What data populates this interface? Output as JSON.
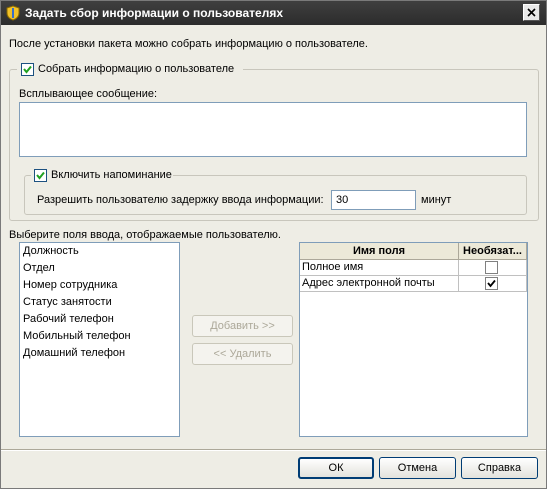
{
  "window": {
    "title": "Задать сбор информации о пользователях"
  },
  "intro_text": "После установки пакета можно собрать информацию о пользователе.",
  "collect_group": {
    "checkbox_label": "Собрать информацию о пользователе",
    "checked": true,
    "popup_label": "Всплывающее сообщение:",
    "popup_value": "",
    "reminder": {
      "checkbox_label": "Включить напоминание",
      "checked": true,
      "delay_label": "Разрешить пользователю задержку ввода информации:",
      "delay_value": "30",
      "delay_unit": "минут"
    }
  },
  "fields": {
    "choose_label": "Выберите поля ввода, отображаемые пользователю.",
    "available": [
      "Должность",
      "Отдел",
      "Номер сотрудника",
      "Статус занятости",
      "Рабочий телефон",
      "Мобильный телефон",
      "Домашний телефон"
    ],
    "add_button": "Добавить >>",
    "remove_button": "<< Удалить",
    "table": {
      "columns": [
        "Имя поля",
        "Необязат..."
      ],
      "rows": [
        {
          "name": "Полное имя",
          "optional": false
        },
        {
          "name": "Адрес электронной почты",
          "optional": true
        }
      ]
    }
  },
  "footer": {
    "ok": "ОК",
    "cancel": "Отмена",
    "help": "Справка"
  }
}
